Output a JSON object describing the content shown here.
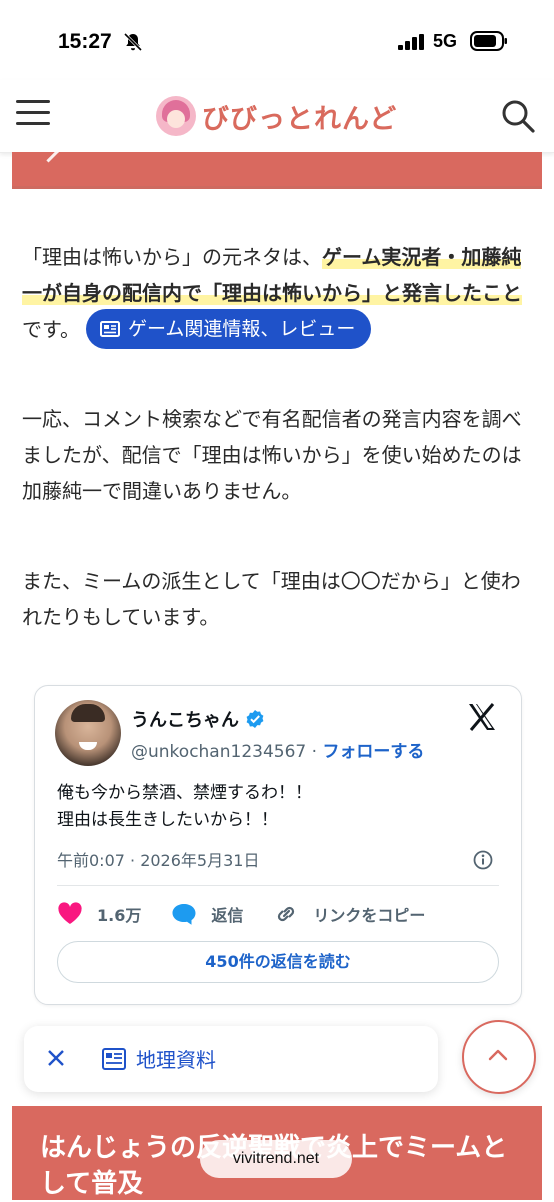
{
  "status_bar": {
    "time": "15:27",
    "network": "5G"
  },
  "header": {
    "site_name": "びびっとれんど"
  },
  "article": {
    "p1_before": "「理由は怖いから」の元ネタは、",
    "p1_highlight": "ゲーム実況者・加藤純一が自身の配信内で「理由は怖いから」と発言したこと",
    "p1_after": "です。",
    "tag_pill": "ゲーム関連情報、レビュー",
    "p2": "一応、コメント検索などで有名配信者の発言内容を調べましたが、配信で「理由は怖いから」を使い始めたのは加藤純一で間違いありません。",
    "p3": "また、ミームの派生として「理由は〇〇だから」と使われたりもしています。"
  },
  "tweet": {
    "name": "うんこちゃん",
    "handle": "@unkochan1234567",
    "separator": " · ",
    "follow": "フォローする",
    "line1": "俺も今から禁酒、禁煙するわ！！",
    "line2": "理由は長生きしたいから！！",
    "date": "午前0:07 · 2026年5月31日",
    "likes": "1.6万",
    "reply": "返信",
    "copy_link": "リンクをコピー",
    "read_replies": "450件の返信を読む",
    "colors": {
      "like": "#f91880",
      "reply": "#1d9bf0",
      "link": "#1d63c9"
    }
  },
  "floating_bar": {
    "label": "地理資料"
  },
  "bottom": {
    "heading": "はんじょうの反逆聖戦で炎上でミームとして普及",
    "domain": "vivitrend.net"
  },
  "colors": {
    "accent": "#d9695f",
    "pill": "#1f52c9",
    "highlight": "#fff4a3"
  }
}
